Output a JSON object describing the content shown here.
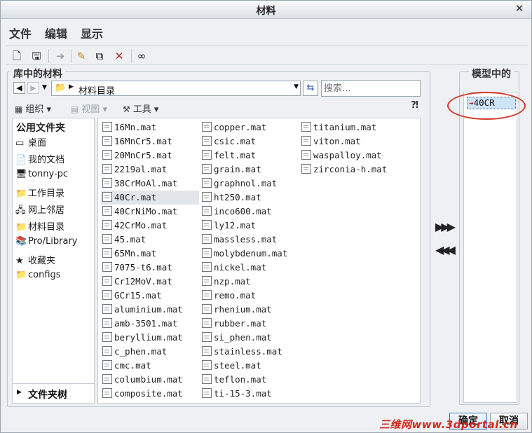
{
  "window": {
    "title": "材料"
  },
  "menu": [
    "文件",
    "编辑",
    "显示"
  ],
  "library": {
    "group_label": "库中的材料",
    "address": "材料目录",
    "search_placeholder": "搜索...",
    "toolbar": {
      "organize": "组织",
      "view": "视图",
      "tools": "工具"
    },
    "places_header": "公用文件夹",
    "places": [
      {
        "label": "桌面",
        "icon": "desktop-icon"
      },
      {
        "label": "我的文档",
        "icon": "documents-icon"
      },
      {
        "label": "tonny-pc",
        "icon": "computer-icon"
      },
      {
        "label": "工作目录",
        "icon": "folder-icon"
      },
      {
        "label": "网上邻居",
        "icon": "network-icon"
      },
      {
        "label": "材料目录",
        "icon": "folder-icon"
      },
      {
        "label": "Pro/Library",
        "icon": "library-icon"
      },
      {
        "label": "收藏夹",
        "icon": "favorites-icon"
      },
      {
        "label": "configs",
        "icon": "folder-icon"
      }
    ],
    "folder_tree": "文件夹树",
    "columns": [
      [
        "16Mn.mat",
        "16MnCr5.mat",
        "20MnCr5.mat",
        "2219al.mat",
        "38CrMoAl.mat",
        "40Cr.mat",
        "40CrNiMo.mat",
        "42CrMo.mat",
        "45.mat",
        "65Mn.mat",
        "7075-t6.mat",
        "Cr12MoV.mat",
        "GCr15.mat",
        "aluminium.mat",
        "amb-3501.mat",
        "beryllium.mat",
        "c_phen.mat",
        "cmc.mat",
        "columbium.mat",
        "composite.mat"
      ],
      [
        "copper.mat",
        "csic.mat",
        "felt.mat",
        "grain.mat",
        "graphnol.mat",
        "ht250.mat",
        "inco600.mat",
        "ly12.mat",
        "massless.mat",
        "molybdenum.mat",
        "nickel.mat",
        "nzp.mat",
        "remo.mat",
        "rhenium.mat",
        "rubber.mat",
        "si_phen.mat",
        "stainless.mat",
        "steel.mat",
        "teflon.mat",
        "ti-15-3.mat"
      ],
      [
        "titanium.mat",
        "viton.mat",
        "waspalloy.mat",
        "zirconia-h.mat"
      ]
    ],
    "selected_file": "40Cr.mat"
  },
  "model": {
    "group_label": "模型中的",
    "items": [
      "40CR"
    ]
  },
  "buttons": {
    "ok": "确定",
    "cancel": "取消"
  },
  "watermark": "三维网www.3dportal.cn",
  "colors": {
    "highlight_circle": "#d23a2a",
    "selection": "#cfe3f6"
  }
}
